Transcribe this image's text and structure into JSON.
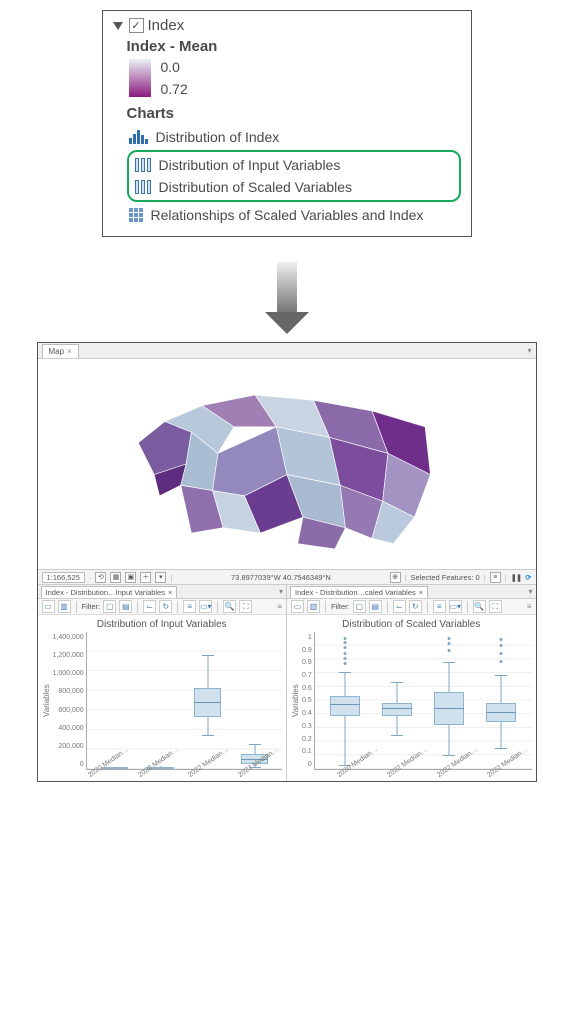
{
  "toc": {
    "layer_name": "Index",
    "checked": "✓",
    "legend_title": "Index - Mean",
    "min_label": "0.0",
    "max_label": "0.72",
    "charts_heading": "Charts",
    "items": [
      {
        "label": "Distribution of Index"
      },
      {
        "label": "Distribution of Input Variables"
      },
      {
        "label": "Distribution of Scaled Variables"
      },
      {
        "label": "Relationships of Scaled Variables and Index"
      }
    ]
  },
  "app": {
    "map_tab": "Map",
    "close_glyph": "×",
    "scale": "1:166,525",
    "coords": "73.8977039°W 40.7546349°N",
    "selected_label": "Selected Features: 0",
    "pause_glyph": "❚❚",
    "refresh_glyph": "⟳",
    "toolbar": {
      "filter_label": "Filter:"
    },
    "left_chart": {
      "tab": "Index - Distribution…Input Variables",
      "title": "Distribution of Input Variables"
    },
    "right_chart": {
      "tab": "Index - Distribution…caled Variables",
      "title": "Distribution of Scaled Variables"
    },
    "x_categories": [
      "2020 Median…",
      "2022 Median…",
      "2022 Median…",
      "2022 Median…"
    ],
    "axis_label": "Variables"
  },
  "chart_data": [
    {
      "type": "boxplot",
      "title": "Distribution of Input Variables",
      "ylabel": "Variables",
      "ylim": [
        0,
        1400000
      ],
      "y_ticks": [
        "1,400,000",
        "1,200,000",
        "1,000,000",
        "800,000",
        "600,000",
        "400,000",
        "200,000",
        "0"
      ],
      "categories": [
        "2020 Median…",
        "2022 Median…",
        "2022 Median…",
        "2022 Median…"
      ],
      "series": [
        {
          "name": "2020 Median…",
          "min": 0,
          "q1": 2000,
          "median": 4000,
          "q3": 8000,
          "max": 15000
        },
        {
          "name": "2022 Median…",
          "min": 0,
          "q1": 3000,
          "median": 6000,
          "q3": 12000,
          "max": 25000
        },
        {
          "name": "2022 Median…",
          "min": 350000,
          "q1": 550000,
          "median": 700000,
          "q3": 850000,
          "max": 1200000
        },
        {
          "name": "2022 Median…",
          "min": 10000,
          "q1": 60000,
          "median": 100000,
          "q3": 150000,
          "max": 260000
        }
      ]
    },
    {
      "type": "boxplot",
      "title": "Distribution of Scaled Variables",
      "ylabel": "Variables",
      "ylim": [
        0,
        1
      ],
      "y_ticks": [
        "1",
        "0.9",
        "0.8",
        "0.7",
        "0.6",
        "0.5",
        "0.4",
        "0.3",
        "0.2",
        "0.1",
        "0"
      ],
      "categories": [
        "2020 Median…",
        "2022 Median…",
        "2022 Median…",
        "2022 Median…"
      ],
      "series": [
        {
          "name": "2020 Median…",
          "min": 0.02,
          "q1": 0.4,
          "median": 0.48,
          "q3": 0.55,
          "max": 0.72,
          "outliers": [
            0.78,
            0.82,
            0.86,
            0.9,
            0.94,
            0.97
          ]
        },
        {
          "name": "2022 Median…",
          "min": 0.25,
          "q1": 0.4,
          "median": 0.45,
          "q3": 0.5,
          "max": 0.65
        },
        {
          "name": "2022 Median…",
          "min": 0.1,
          "q1": 0.33,
          "median": 0.45,
          "q3": 0.58,
          "max": 0.8,
          "outliers": [
            0.88,
            0.93,
            0.97
          ]
        },
        {
          "name": "2022 Median…",
          "min": 0.15,
          "q1": 0.35,
          "median": 0.42,
          "q3": 0.5,
          "max": 0.7,
          "outliers": [
            0.8,
            0.86,
            0.92,
            0.96
          ]
        }
      ]
    }
  ]
}
